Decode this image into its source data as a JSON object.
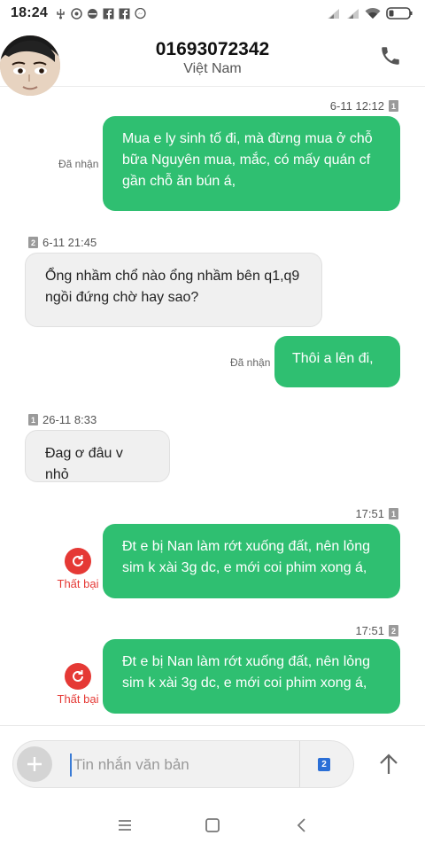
{
  "status_bar": {
    "time": "18:24",
    "icons": [
      "usb-icon",
      "sync-icon",
      "browser-icon",
      "facebook-icon",
      "facebook-icon",
      "messenger-icon"
    ],
    "right_icons": [
      "signal-icon",
      "signal-icon",
      "wifi-icon",
      "battery-icon"
    ]
  },
  "header": {
    "contact_number": "01693072342",
    "contact_location": "Việt Nam"
  },
  "messages": [
    {
      "direction": "out",
      "time": "6-11 12:12",
      "sim": "1",
      "status": "Đã nhận",
      "text": "Mua e ly sinh tố đi, mà đừng mua ở chỗ bữa Nguyên mua, mắc, có mấy quán cf gần chỗ ăn bún á,"
    },
    {
      "direction": "in",
      "time": "6-11 21:45",
      "sim": "2",
      "text": "Ổng nhầm chổ nào ổng nhầm bên q1,q9 ngồi đứng chờ  hay sao?"
    },
    {
      "direction": "out",
      "status": "Đã nhận",
      "text": "Thôi a lên đi,"
    },
    {
      "direction": "in",
      "time": "26-11 8:33",
      "sim": "1",
      "text": "Đag ơ đâu v nhỏ"
    },
    {
      "direction": "out",
      "time": "17:51",
      "sim": "1",
      "status": "Thất bại",
      "text": "Đt e bị Nan làm rớt xuống đất, nên lỏng sim k xài 3g dc, e mới coi phim xong á,"
    },
    {
      "direction": "out",
      "time": "17:51",
      "sim": "2",
      "status": "Thất bại",
      "text": "Đt e bị Nan làm rớt xuống đất, nên lỏng sim k xài 3g dc, e mới coi phim xong á,"
    }
  ],
  "composer": {
    "placeholder": "Tin nhắn văn bản",
    "sim_slot": "2"
  },
  "colors": {
    "outgoing_bubble": "#2fbf71",
    "incoming_bubble": "#f0f0f0",
    "failed": "#e53935",
    "sim_button": "#2b6fd6"
  }
}
